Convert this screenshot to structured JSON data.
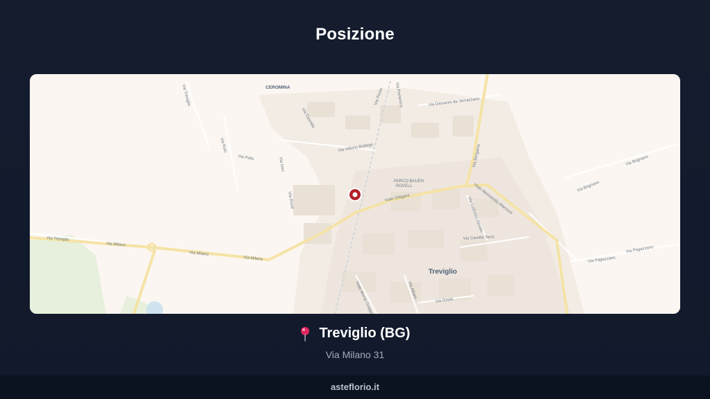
{
  "header": {
    "title": "Posizione"
  },
  "map": {
    "labels": {
      "ceromina": "CEROMINA",
      "treviglio": "Treviglio",
      "parco": "PARCO BAUEN",
      "parco2": "ROVELL",
      "via_treviglio_top": "Via Treviglio",
      "via_treviglio_left": "Via Treviglio",
      "via_milano_1": "Via Milano",
      "via_milano_2": "Via Milano",
      "via_milano_3": "Via Milano",
      "viale_ortigara": "Viale Ortigara",
      "via_bergamo": "Via Bergamo",
      "viale_manzoni": "Viale Alessandro Manzoni",
      "via_vittorio": "Via Vittorio Bottego",
      "via_verrazzano": "Via Giovanni da Verrazzano",
      "via_brignano_1": "Via Brignano",
      "via_brignano_2": "Via Brignano",
      "via_pagazzano_1": "Via Pagazzano",
      "via_pagazzano_2": "Via Pagazzano",
      "via_camillo": "Via Camillo Terni",
      "via_lodovico": "Via Lodovico Ariosto",
      "viale_monte": "Viale Monte Grappa",
      "via_palis": "Via Palis",
      "via_roio": "Via Roio",
      "via_isso": "Via Isso",
      "via_casnida": "Via Casnida",
      "via_rossi": "Via Rossi",
      "via_orsini": "Via Orsini",
      "via_albani": "Via Albani",
      "via_ponte": "Via Ponte",
      "via_pontevico": "Via Pontevico"
    },
    "marker_icon": "map-marker-icon"
  },
  "location": {
    "pin_icon": "pushpin-icon",
    "city": "Treviglio (BG)",
    "address": "Via Milano 31"
  },
  "footer": {
    "brand": "asteflorio.it"
  }
}
